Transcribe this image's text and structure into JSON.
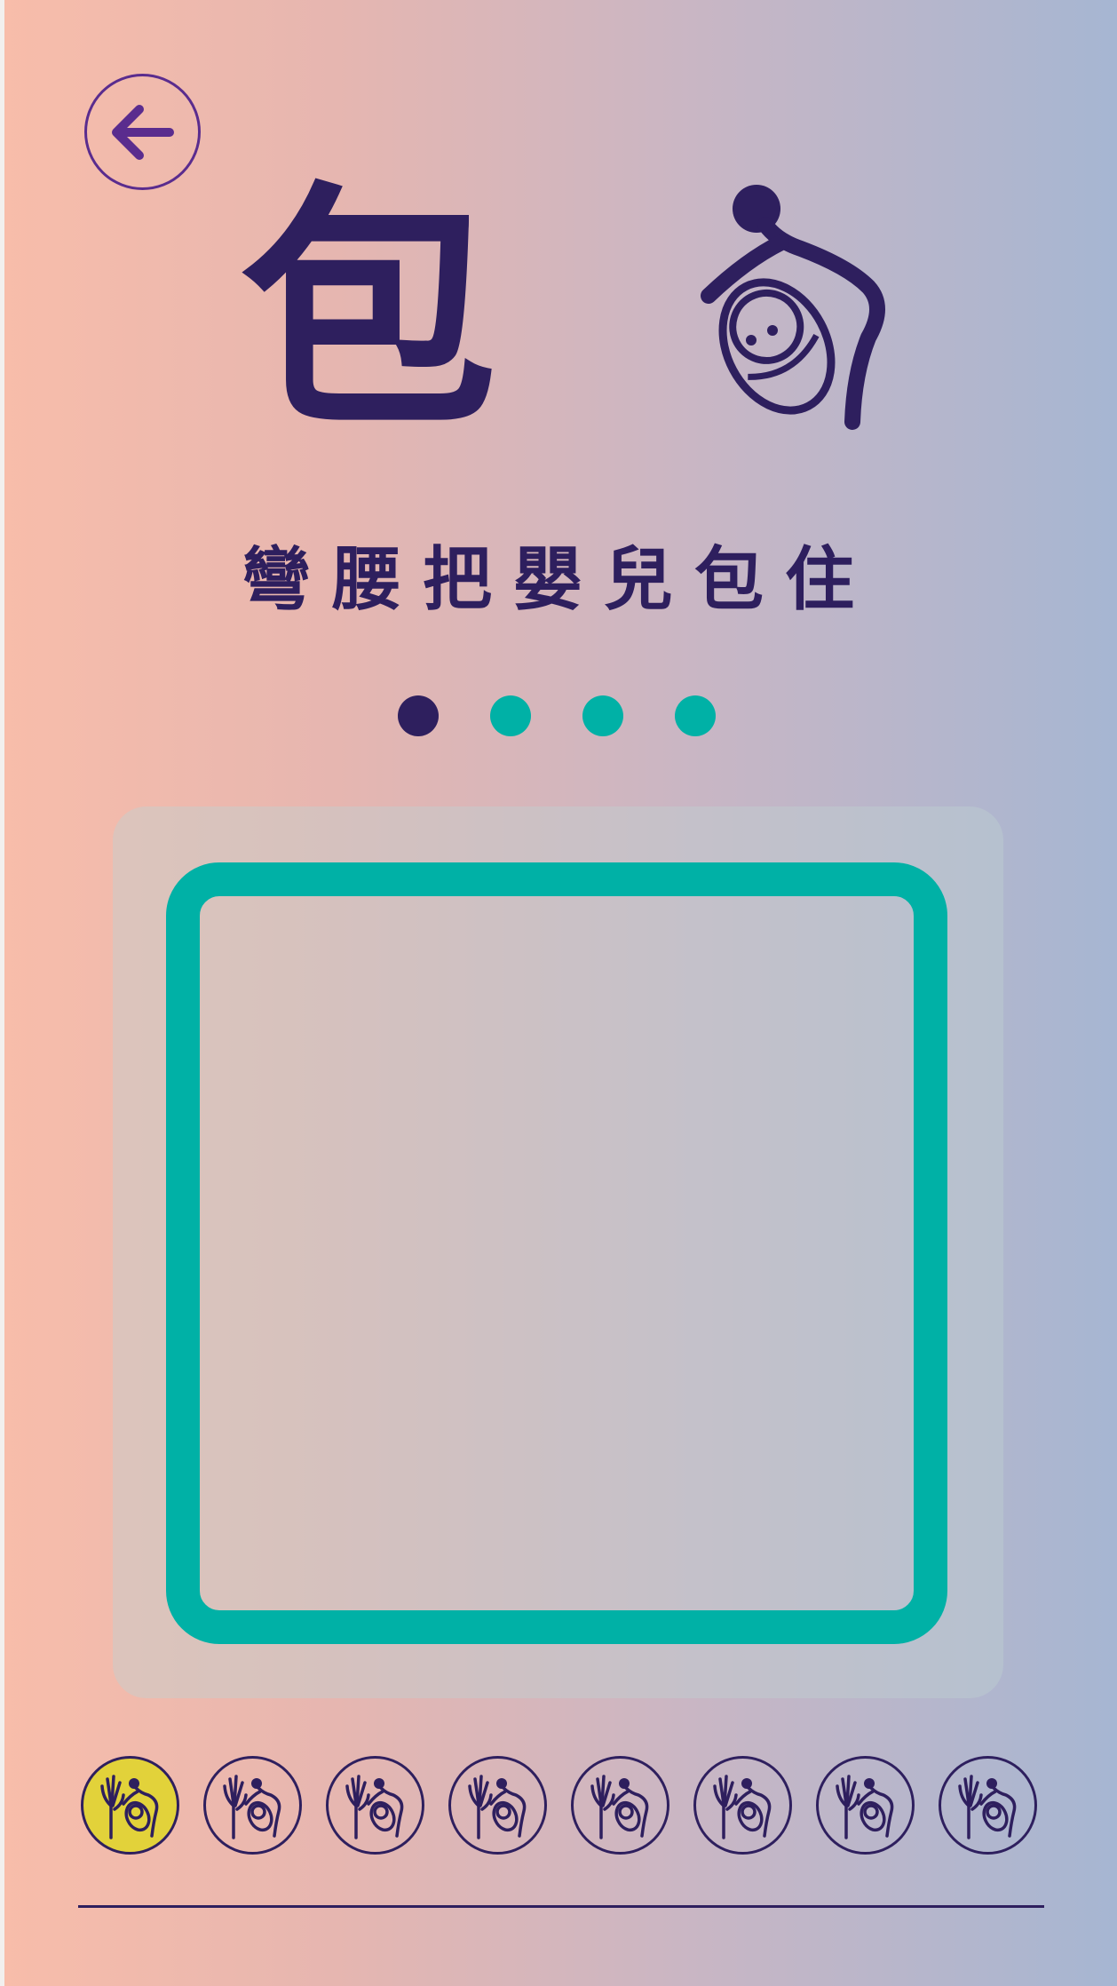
{
  "header": {
    "back_icon": "arrow-left-icon",
    "character": "包",
    "pictograph_icon": "person-wrapping-baby-icon",
    "meaning": "彎腰把嬰兒包住"
  },
  "pager": {
    "total": 4,
    "active_index": 0
  },
  "canvas": {
    "frame_color": "#00b1a6"
  },
  "thumbnails": {
    "count": 8,
    "selected_index": 0,
    "icon": "person-wrapping-baby-icon"
  },
  "colors": {
    "ink": "#2e1f5e",
    "accent": "#00b1a6",
    "highlight": "#e2d23a",
    "back_button": "#5a2c8e"
  }
}
